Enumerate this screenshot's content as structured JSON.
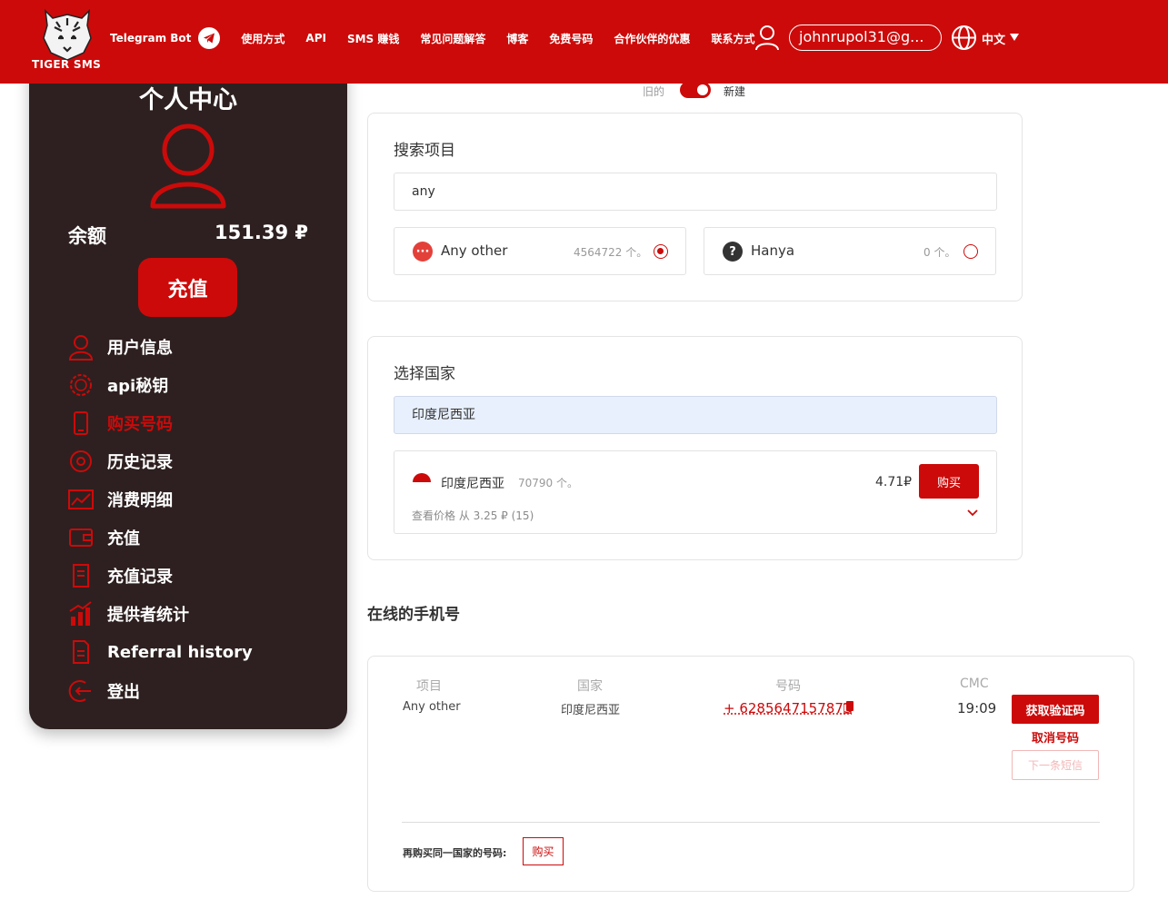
{
  "header": {
    "logo_text": "TIGER SMS",
    "nav": [
      {
        "label": "Telegram Bot"
      },
      {
        "label": "使用方式"
      },
      {
        "label": "API"
      },
      {
        "label": "SMS 赚钱"
      },
      {
        "label": "常见问题解答"
      },
      {
        "label": "博客"
      },
      {
        "label": "免费号码"
      },
      {
        "label": "合作伙伴的优惠"
      },
      {
        "label": "联系方式"
      }
    ],
    "email": "johnrupol31@g...",
    "language": "中文",
    "brand_color": "#cc0a0a"
  },
  "sidebar": {
    "title": "个人中心",
    "balance_label": "余额",
    "balance_value": "151.39 ₽",
    "topup_label": "充值",
    "items": [
      {
        "label": "用户信息",
        "icon": "user-icon"
      },
      {
        "label": "api秘钥",
        "icon": "gear-api-icon"
      },
      {
        "label": "购买号码",
        "icon": "phone-icon",
        "active": true
      },
      {
        "label": "历史记录",
        "icon": "history-icon"
      },
      {
        "label": "消费明细",
        "icon": "chart-icon"
      },
      {
        "label": "充值",
        "icon": "wallet-icon"
      },
      {
        "label": "充值记录",
        "icon": "receipt-icon"
      },
      {
        "label": "提供者统计",
        "icon": "bar-chart-icon"
      },
      {
        "label": "Referral history",
        "icon": "document-icon"
      },
      {
        "label": "登出",
        "icon": "logout-icon"
      }
    ]
  },
  "toggle": {
    "old_label": "旧的",
    "new_label": "新建",
    "state": "new"
  },
  "search_project": {
    "title": "搜索项目",
    "value": "any",
    "options": [
      {
        "name": "Any other",
        "count": "4564722 个。",
        "selected": true,
        "icon": "dots-icon"
      },
      {
        "name": "Hanya",
        "count": "0 个。",
        "selected": false,
        "icon": "question-icon"
      }
    ]
  },
  "select_country": {
    "title": "选择国家",
    "value": "印度尼西亚",
    "result": {
      "name": "印度尼西亚",
      "count": "70790 个。",
      "price": "4.71₽",
      "buy_label": "购买",
      "sub": "查看价格 从 3.25 ₽ (15)"
    }
  },
  "online_numbers": {
    "title": "在线的手机号",
    "headers": [
      "项目",
      "国家",
      "号码",
      "CMC"
    ],
    "row": {
      "project": "Any other",
      "country": "印度尼西亚",
      "number": "+ 6285647157873",
      "timer": "19:09"
    },
    "get_code_label": "获取验证码",
    "cancel_label": "取消号码",
    "next_sms_label": "下一条短信",
    "rebuy_label": "再购买同一国家的号码:",
    "rebuy_button": "购买"
  }
}
